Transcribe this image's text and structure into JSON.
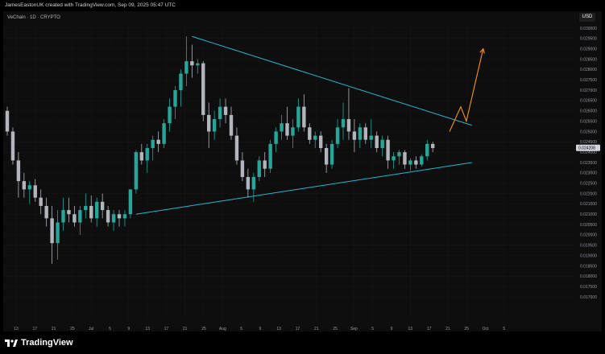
{
  "header": {
    "credit": "JamesEastonUK created with TradingView.com, Sep 09, 2025 05:47 UTC"
  },
  "symbol": {
    "label": "VeChain · 1D · CRYPTO"
  },
  "currency_button": "USD",
  "footer": {
    "brand": "TradingView"
  },
  "chart_data": {
    "type": "candlestick",
    "currency": "USD",
    "y_ticks": [
      "0.030000",
      "0.029500",
      "0.029000",
      "0.028500",
      "0.028000",
      "0.027500",
      "0.027000",
      "0.026500",
      "0.026000",
      "0.025500",
      "0.025000",
      "0.024500",
      "0.024000",
      "0.023500",
      "0.023000",
      "0.022500",
      "0.022000",
      "0.021500",
      "0.021000",
      "0.020500",
      "0.020000",
      "0.019500",
      "0.019000",
      "0.018500",
      "0.018000",
      "0.017500",
      "0.017000"
    ],
    "ylim": [
      0.0168,
      0.0303
    ],
    "current_price": "0.024208",
    "x_ticks": [
      "13",
      "17",
      "21",
      "25",
      "Jul",
      "5",
      "9",
      "13",
      "17",
      "21",
      "25",
      "Aug",
      "5",
      "9",
      "13",
      "17",
      "21",
      "25",
      "Sep",
      "5",
      "9",
      "13",
      "17",
      "21",
      "25",
      "Oct",
      "5"
    ],
    "candles": [
      {
        "o": 0.026,
        "h": 0.0262,
        "l": 0.0248,
        "c": 0.025
      },
      {
        "o": 0.025,
        "h": 0.0252,
        "l": 0.0234,
        "c": 0.0236
      },
      {
        "o": 0.0236,
        "h": 0.024,
        "l": 0.0218,
        "c": 0.0226
      },
      {
        "o": 0.0226,
        "h": 0.023,
        "l": 0.0218,
        "c": 0.0222
      },
      {
        "o": 0.0222,
        "h": 0.0226,
        "l": 0.0215,
        "c": 0.0224
      },
      {
        "o": 0.0224,
        "h": 0.0227,
        "l": 0.0216,
        "c": 0.0218
      },
      {
        "o": 0.0218,
        "h": 0.0222,
        "l": 0.021,
        "c": 0.0214
      },
      {
        "o": 0.0214,
        "h": 0.0218,
        "l": 0.0204,
        "c": 0.0208
      },
      {
        "o": 0.0208,
        "h": 0.0214,
        "l": 0.0186,
        "c": 0.0196
      },
      {
        "o": 0.0196,
        "h": 0.0212,
        "l": 0.0188,
        "c": 0.0206
      },
      {
        "o": 0.0206,
        "h": 0.0218,
        "l": 0.0202,
        "c": 0.0212
      },
      {
        "o": 0.0212,
        "h": 0.0218,
        "l": 0.0206,
        "c": 0.021
      },
      {
        "o": 0.021,
        "h": 0.0214,
        "l": 0.0204,
        "c": 0.0206
      },
      {
        "o": 0.0206,
        "h": 0.0214,
        "l": 0.02,
        "c": 0.0212
      },
      {
        "o": 0.0212,
        "h": 0.022,
        "l": 0.0208,
        "c": 0.0214
      },
      {
        "o": 0.0214,
        "h": 0.0219,
        "l": 0.0206,
        "c": 0.0208
      },
      {
        "o": 0.0208,
        "h": 0.0218,
        "l": 0.0204,
        "c": 0.0216
      },
      {
        "o": 0.0216,
        "h": 0.022,
        "l": 0.0208,
        "c": 0.0212
      },
      {
        "o": 0.0212,
        "h": 0.0214,
        "l": 0.0204,
        "c": 0.0206
      },
      {
        "o": 0.0206,
        "h": 0.0212,
        "l": 0.0202,
        "c": 0.021
      },
      {
        "o": 0.021,
        "h": 0.0212,
        "l": 0.0204,
        "c": 0.0208
      },
      {
        "o": 0.0208,
        "h": 0.0212,
        "l": 0.0204,
        "c": 0.021
      },
      {
        "o": 0.021,
        "h": 0.0222,
        "l": 0.0208,
        "c": 0.0222
      },
      {
        "o": 0.0222,
        "h": 0.0241,
        "l": 0.022,
        "c": 0.024
      },
      {
        "o": 0.024,
        "h": 0.0244,
        "l": 0.0234,
        "c": 0.0236
      },
      {
        "o": 0.0236,
        "h": 0.0244,
        "l": 0.023,
        "c": 0.0242
      },
      {
        "o": 0.0242,
        "h": 0.0248,
        "l": 0.0236,
        "c": 0.0246
      },
      {
        "o": 0.0246,
        "h": 0.025,
        "l": 0.024,
        "c": 0.0244
      },
      {
        "o": 0.0244,
        "h": 0.0256,
        "l": 0.0242,
        "c": 0.0254
      },
      {
        "o": 0.0254,
        "h": 0.0266,
        "l": 0.025,
        "c": 0.0262
      },
      {
        "o": 0.0262,
        "h": 0.0272,
        "l": 0.0256,
        "c": 0.027
      },
      {
        "o": 0.027,
        "h": 0.028,
        "l": 0.0262,
        "c": 0.0278
      },
      {
        "o": 0.0278,
        "h": 0.0296,
        "l": 0.0272,
        "c": 0.0284
      },
      {
        "o": 0.0284,
        "h": 0.0292,
        "l": 0.0276,
        "c": 0.0282
      },
      {
        "o": 0.0282,
        "h": 0.0285,
        "l": 0.0278,
        "c": 0.0283
      },
      {
        "o": 0.0283,
        "h": 0.0284,
        "l": 0.0255,
        "c": 0.0258
      },
      {
        "o": 0.0258,
        "h": 0.0264,
        "l": 0.0242,
        "c": 0.025
      },
      {
        "o": 0.025,
        "h": 0.026,
        "l": 0.0246,
        "c": 0.0256
      },
      {
        "o": 0.0256,
        "h": 0.0266,
        "l": 0.0252,
        "c": 0.0262
      },
      {
        "o": 0.0262,
        "h": 0.0266,
        "l": 0.0254,
        "c": 0.0258
      },
      {
        "o": 0.0258,
        "h": 0.0262,
        "l": 0.0246,
        "c": 0.0248
      },
      {
        "o": 0.0248,
        "h": 0.0252,
        "l": 0.0234,
        "c": 0.0236
      },
      {
        "o": 0.0236,
        "h": 0.024,
        "l": 0.0226,
        "c": 0.0228
      },
      {
        "o": 0.0228,
        "h": 0.0232,
        "l": 0.0218,
        "c": 0.0222
      },
      {
        "o": 0.0222,
        "h": 0.023,
        "l": 0.0216,
        "c": 0.0228
      },
      {
        "o": 0.0228,
        "h": 0.0238,
        "l": 0.0226,
        "c": 0.0236
      },
      {
        "o": 0.0236,
        "h": 0.024,
        "l": 0.0228,
        "c": 0.0232
      },
      {
        "o": 0.0232,
        "h": 0.0246,
        "l": 0.023,
        "c": 0.0244
      },
      {
        "o": 0.0244,
        "h": 0.0252,
        "l": 0.024,
        "c": 0.025
      },
      {
        "o": 0.025,
        "h": 0.0258,
        "l": 0.0246,
        "c": 0.0254
      },
      {
        "o": 0.0254,
        "h": 0.0262,
        "l": 0.0246,
        "c": 0.0248
      },
      {
        "o": 0.0248,
        "h": 0.0256,
        "l": 0.0242,
        "c": 0.0252
      },
      {
        "o": 0.0252,
        "h": 0.0266,
        "l": 0.025,
        "c": 0.0262
      },
      {
        "o": 0.0262,
        "h": 0.0268,
        "l": 0.025,
        "c": 0.0252
      },
      {
        "o": 0.0252,
        "h": 0.0254,
        "l": 0.0244,
        "c": 0.0246
      },
      {
        "o": 0.0246,
        "h": 0.025,
        "l": 0.0242,
        "c": 0.0248
      },
      {
        "o": 0.0248,
        "h": 0.025,
        "l": 0.024,
        "c": 0.0242
      },
      {
        "o": 0.0242,
        "h": 0.0244,
        "l": 0.023,
        "c": 0.0234
      },
      {
        "o": 0.0234,
        "h": 0.0246,
        "l": 0.0232,
        "c": 0.0244
      },
      {
        "o": 0.0244,
        "h": 0.0256,
        "l": 0.0242,
        "c": 0.0252
      },
      {
        "o": 0.0252,
        "h": 0.0264,
        "l": 0.0246,
        "c": 0.0256
      },
      {
        "o": 0.0256,
        "h": 0.0271,
        "l": 0.0246,
        "c": 0.025
      },
      {
        "o": 0.025,
        "h": 0.0256,
        "l": 0.024,
        "c": 0.0246
      },
      {
        "o": 0.0246,
        "h": 0.0254,
        "l": 0.0242,
        "c": 0.0252
      },
      {
        "o": 0.0252,
        "h": 0.0254,
        "l": 0.0244,
        "c": 0.0246
      },
      {
        "o": 0.0246,
        "h": 0.0256,
        "l": 0.0242,
        "c": 0.0248
      },
      {
        "o": 0.0248,
        "h": 0.025,
        "l": 0.024,
        "c": 0.0242
      },
      {
        "o": 0.0242,
        "h": 0.0248,
        "l": 0.0238,
        "c": 0.0246
      },
      {
        "o": 0.0246,
        "h": 0.0248,
        "l": 0.0232,
        "c": 0.0236
      },
      {
        "o": 0.0236,
        "h": 0.024,
        "l": 0.0232,
        "c": 0.0238
      },
      {
        "o": 0.0238,
        "h": 0.0241,
        "l": 0.0234,
        "c": 0.024
      },
      {
        "o": 0.024,
        "h": 0.0241,
        "l": 0.0232,
        "c": 0.0234
      },
      {
        "o": 0.0234,
        "h": 0.0237,
        "l": 0.0231,
        "c": 0.0236
      },
      {
        "o": 0.0236,
        "h": 0.0238,
        "l": 0.0232,
        "c": 0.0234
      },
      {
        "o": 0.0234,
        "h": 0.0239,
        "l": 0.0233,
        "c": 0.0238
      },
      {
        "o": 0.0238,
        "h": 0.0246,
        "l": 0.0236,
        "c": 0.0244
      },
      {
        "o": 0.0244,
        "h": 0.0245,
        "l": 0.024,
        "c": 0.0242
      }
    ],
    "trendlines": [
      {
        "name": "upper",
        "color": "#29b6d4",
        "from": [
          33,
          0.0296
        ],
        "to": [
          83,
          0.0253
        ]
      },
      {
        "name": "lower",
        "color": "#29b6d4",
        "from": [
          23,
          0.021
        ],
        "to": [
          83,
          0.0235
        ]
      }
    ],
    "projection": {
      "color": "#f7931a",
      "points": [
        [
          79,
          0.025
        ],
        [
          81,
          0.0262
        ],
        [
          82,
          0.0255
        ],
        [
          85,
          0.029
        ]
      ]
    }
  }
}
